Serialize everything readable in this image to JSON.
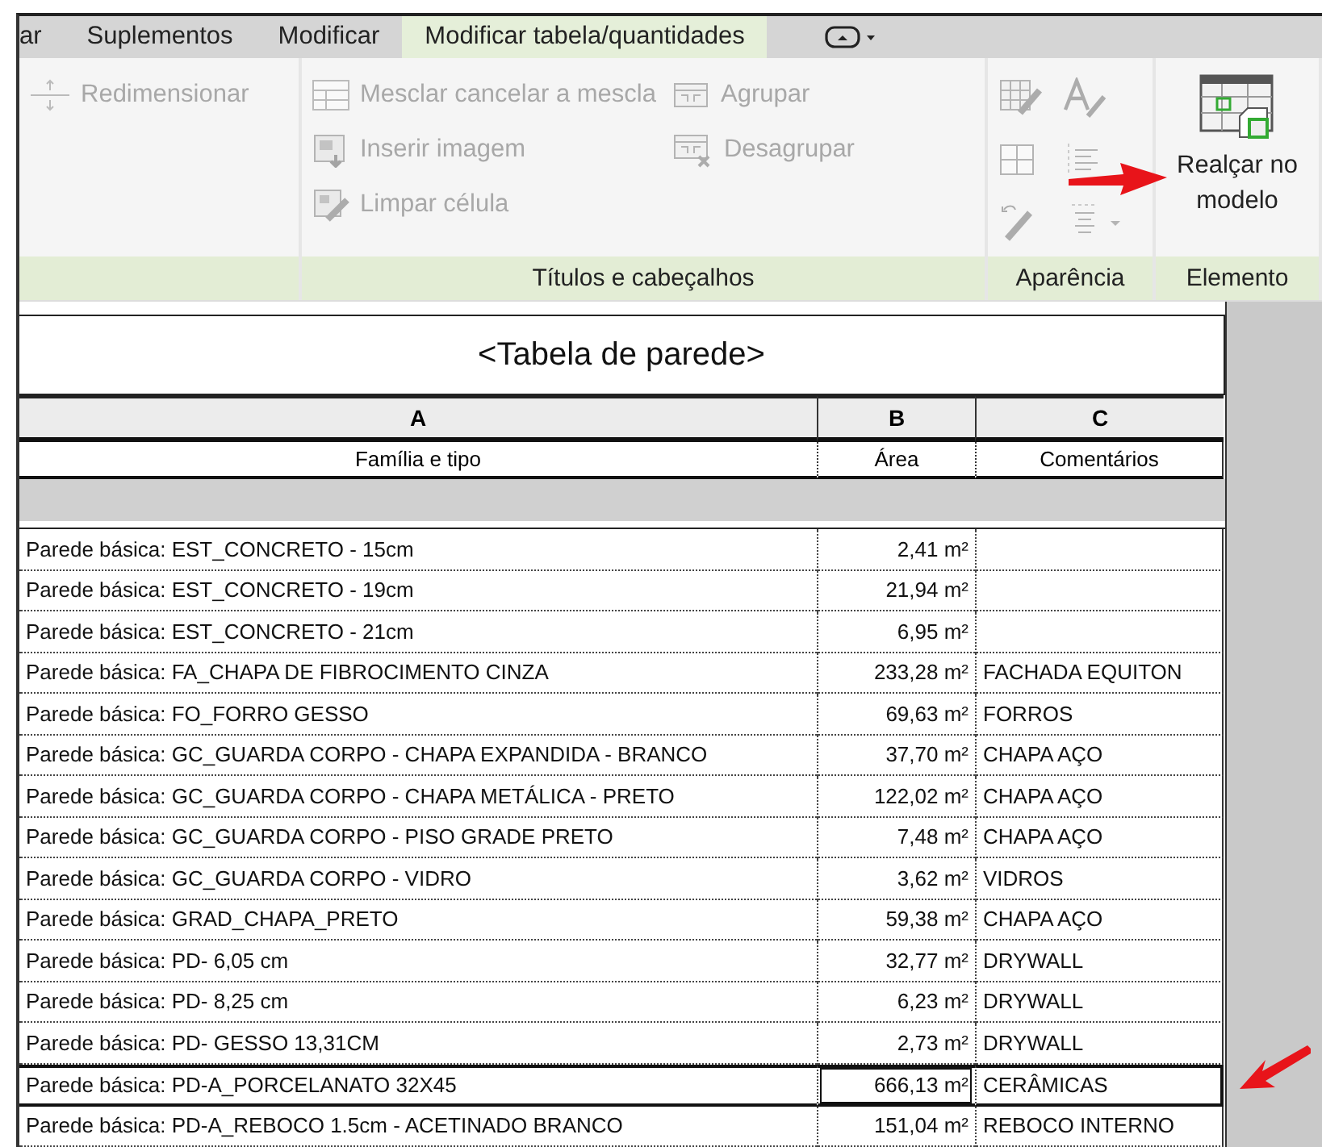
{
  "tabs": [
    {
      "label": "ar",
      "selected": false
    },
    {
      "label": "Suplementos",
      "selected": false
    },
    {
      "label": "Modificar",
      "selected": false
    },
    {
      "label": "Modificar tabela/quantidades",
      "selected": true
    }
  ],
  "ribbon": {
    "panels": [
      {
        "buttons": [
          {
            "label": "Redimensionar",
            "disabled": true
          }
        ]
      },
      {
        "label": "Títulos e cabeçalhos",
        "buttons": [
          {
            "label": "Mesclar  cancelar a mescla",
            "disabled": true
          },
          {
            "label": "Inserir  imagem",
            "disabled": true
          },
          {
            "label": "Limpar  célula",
            "disabled": true
          },
          {
            "label": "Agrupar",
            "disabled": true
          },
          {
            "label": "Desagrupar",
            "disabled": true
          }
        ]
      },
      {
        "label": "Aparência",
        "buttons": [
          {
            "disabled": true
          },
          {
            "disabled": true
          },
          {
            "disabled": true
          },
          {
            "disabled": true
          },
          {
            "disabled": true
          },
          {
            "disabled": true
          }
        ]
      },
      {
        "label": "Elemento",
        "buttons": [
          {
            "label": "Realçar no modelo",
            "disabled": false
          }
        ]
      }
    ]
  },
  "schedule": {
    "title": "<Tabela de parede>",
    "column_letters": [
      "A",
      "B",
      "C"
    ],
    "headers": [
      "Família e tipo",
      "Área",
      "Comentários"
    ],
    "rows": [
      {
        "cells": [
          "Parede básica: EST_CONCRETO - 15cm",
          "2,41 m²",
          ""
        ],
        "selected": false
      },
      {
        "cells": [
          "Parede básica: EST_CONCRETO - 19cm",
          "21,94 m²",
          ""
        ],
        "selected": false
      },
      {
        "cells": [
          "Parede básica: EST_CONCRETO - 21cm",
          "6,95 m²",
          ""
        ],
        "selected": false
      },
      {
        "cells": [
          "Parede básica: FA_CHAPA DE FIBROCIMENTO CINZA",
          "233,28 m²",
          "FACHADA EQUITON"
        ],
        "selected": false
      },
      {
        "cells": [
          "Parede básica: FO_FORRO GESSO",
          "69,63 m²",
          "FORROS"
        ],
        "selected": false
      },
      {
        "cells": [
          "Parede básica: GC_GUARDA CORPO - CHAPA EXPANDIDA - BRANCO",
          "37,70 m²",
          "CHAPA AÇO"
        ],
        "selected": false
      },
      {
        "cells": [
          "Parede básica: GC_GUARDA CORPO - CHAPA METÁLICA - PRETO",
          "122,02 m²",
          "CHAPA AÇO"
        ],
        "selected": false
      },
      {
        "cells": [
          "Parede básica: GC_GUARDA CORPO - PISO GRADE PRETO",
          "7,48 m²",
          "CHAPA AÇO"
        ],
        "selected": false
      },
      {
        "cells": [
          "Parede básica: GC_GUARDA CORPO - VIDRO",
          "3,62 m²",
          "VIDROS"
        ],
        "selected": false
      },
      {
        "cells": [
          "Parede básica: GRAD_CHAPA_PRETO",
          "59,38 m²",
          "CHAPA AÇO"
        ],
        "selected": false
      },
      {
        "cells": [
          "Parede básica: PD- 6,05 cm",
          "32,77 m²",
          "DRYWALL"
        ],
        "selected": false
      },
      {
        "cells": [
          "Parede básica: PD-  8,25 cm",
          "6,23 m²",
          "DRYWALL"
        ],
        "selected": false
      },
      {
        "cells": [
          "Parede básica: PD- GESSO 13,31CM",
          "2,73 m²",
          "DRYWALL"
        ],
        "selected": false
      },
      {
        "cells": [
          "Parede básica: PD-A_PORCELANATO 32X45",
          "666,13 m²",
          "CERÂMICAS"
        ],
        "selected": true
      },
      {
        "cells": [
          "Parede básica: PD-A_REBOCO 1.5cm - ACETINADO BRANCO",
          "151,04 m²",
          "REBOCO INTERNO"
        ],
        "selected": false
      }
    ]
  }
}
